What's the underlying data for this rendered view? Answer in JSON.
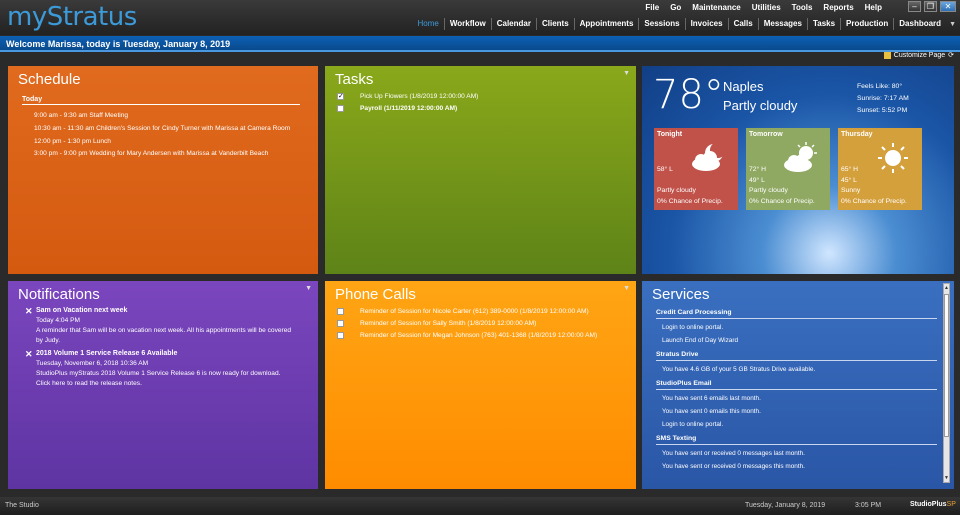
{
  "app": {
    "logo": "myStratus",
    "menu": [
      "File",
      "Go",
      "Maintenance",
      "Utilities",
      "Tools",
      "Reports",
      "Help"
    ],
    "window_buttons": [
      "minimize",
      "restore",
      "close"
    ]
  },
  "nav": {
    "items": [
      "Home",
      "Workflow",
      "Calendar",
      "Clients",
      "Appointments",
      "Sessions",
      "Invoices",
      "Calls",
      "Messages",
      "Tasks",
      "Production",
      "Dashboard"
    ],
    "active": "Home"
  },
  "welcome": "Welcome Marissa, today is Tuesday, January 8, 2019",
  "customize": "Customize Page",
  "schedule": {
    "title": "Schedule",
    "section": "Today",
    "items": [
      "9:00 am - 9:30 am  Staff Meeting",
      "10:30 am - 11:30 am  Children's Session for Cindy Turner with Marissa at Camera Room",
      "12:00 pm - 1:30 pm  Lunch",
      "3:00 pm - 9:00 pm  Wedding for Mary Andersen with Marissa at Vanderbilt Beach"
    ]
  },
  "tasks": {
    "title": "Tasks",
    "items": [
      {
        "label": "Pick Up Flowers (1/8/2019 12:00:00 AM)",
        "checked": true,
        "bold": false
      },
      {
        "label": "Payroll (1/11/2019 12:00:00 AM)",
        "checked": false,
        "bold": true
      }
    ]
  },
  "weather": {
    "temp": "78°",
    "city": "Naples",
    "condition": "Partly cloudy",
    "feels_like": "Feels Like: 80°",
    "sunrise": "Sunrise: 7:17 AM",
    "sunset": "Sunset: 5:52 PM",
    "forecast": [
      {
        "day": "Tonight",
        "line1": "58° L",
        "line2": "",
        "cond": "Partly cloudy",
        "precip": "0% Chance of Precip.",
        "color": "#c0524a",
        "icon": "cloud-moon-icon"
      },
      {
        "day": "Tomorrow",
        "line1": "72° H",
        "line2": "49° L",
        "cond": "Partly cloudy",
        "precip": "0% Chance of Precip.",
        "color": "#8fa862",
        "icon": "sun-cloud-icon"
      },
      {
        "day": "Thursday",
        "line1": "65° H",
        "line2": "45° L",
        "cond": "Sunny",
        "precip": "0% Chance of Precip.",
        "color": "#d4a03c",
        "icon": "sun-icon"
      }
    ]
  },
  "notifications": {
    "title": "Notifications",
    "items": [
      {
        "title": "Sam on Vacation next week",
        "date": "Today 4:04 PM",
        "body": "A reminder that Sam will be on vacation next week. All his appointments will be covered by Judy.",
        "link": ""
      },
      {
        "title": "2018 Volume 1 Service Release 6 Available",
        "date": "Tuesday, November 6, 2018 10:36 AM",
        "body": "StudioPlus myStratus 2018 Volume 1 Service Release 6 is now ready for download.",
        "link": "Click here to read the release notes."
      }
    ]
  },
  "phone": {
    "title": "Phone Calls",
    "items": [
      "Reminder of Session for Nicole Carter (612) 389-0000 (1/8/2019 12:00:00 AM)",
      "Reminder of Session for Sally Smith (1/8/2019 12:00:00 AM)",
      "Reminder of Session for Megan Johnson (763) 401-1368 (1/8/2019 12:00:00 AM)"
    ]
  },
  "services": {
    "title": "Services",
    "sections": [
      {
        "heading": "Credit Card Processing",
        "items": [
          "Login to online portal.",
          "Launch End of Day Wizard"
        ]
      },
      {
        "heading": "Stratus Drive",
        "items": [
          "You have 4.6 GB of your 5 GB Stratus Drive available."
        ]
      },
      {
        "heading": "StudioPlus Email",
        "items": [
          "You have sent 6 emails last month.",
          "You have sent 0 emails this month.",
          "Login to online portal."
        ]
      },
      {
        "heading": "SMS Texting",
        "items": [
          "You have sent or received 0 messages last month.",
          "You have sent or received 0 messages this month."
        ]
      }
    ]
  },
  "status": {
    "left": "The Studio",
    "date": "Tuesday, January 8, 2019",
    "time": "3:05 PM",
    "brand_main": "StudioPlus",
    "brand_accent": "SP"
  }
}
